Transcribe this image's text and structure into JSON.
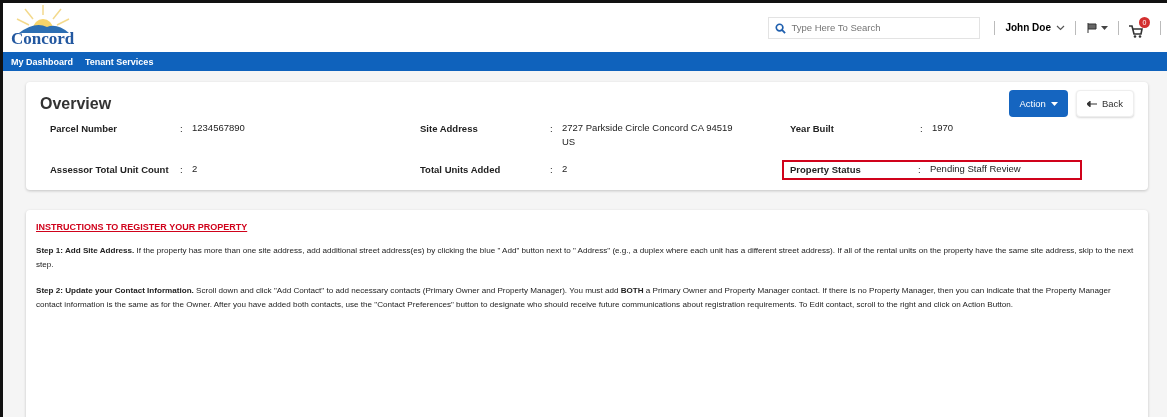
{
  "header": {
    "logo_text": "Concord",
    "search": {
      "placeholder": "Type Here To Search"
    },
    "user": "John Doe",
    "cart_count": "0"
  },
  "nav": [
    {
      "label": "My Dashboard"
    },
    {
      "label": "Tenant Services"
    }
  ],
  "overview": {
    "title": "Overview",
    "buttons": [
      {
        "label": "Action",
        "kind": "primary"
      },
      {
        "label": "Back",
        "kind": "back"
      }
    ],
    "fields": [
      {
        "label": "Parcel Number",
        "separator": ":",
        "value": "1234567890",
        "highlighted": false
      },
      {
        "label": "Site Address",
        "separator": ":",
        "value": "2727 Parkside Circle Concord CA 94519 US",
        "highlighted": false
      },
      {
        "label": "Year Built",
        "separator": ":",
        "value": "1970",
        "highlighted": false
      },
      {
        "label": "Assessor Total Unit Count",
        "separator": ":",
        "value": "2",
        "highlighted": false
      },
      {
        "label": "Total Units Added",
        "separator": ":",
        "value": "2",
        "highlighted": false
      },
      {
        "label": "Property Status",
        "separator": ":",
        "value": "Pending Staff Review",
        "highlighted": true
      }
    ]
  },
  "instructions": {
    "title": "INSTRUCTIONS TO REGISTER YOUR PROPERTY",
    "steps": [
      "**Step 1: Add Site Address.** If the property has more than one site address, add additional street address(es) by clicking the blue \" Add\" button next to \" Address\" (e.g., a duplex where each unit has a different street address). If all of the rental units on the property have the same site address, skip to the next step.",
      "**Step 2: Update your Contact Information.** Scroll down and click \"Add Contact\" to add necessary contacts (Primary Owner and Property Manager). You must add **BOTH** a Primary Owner and Property Manager contact. If there is no Property Manager, then you can indicate that the Property Manager contact information is the same as for the Owner. After you have added both contacts, use the \"Contact Preferences\" button to designate who should receive future communications about registration requirements. To Edit contact, scroll to the right and click on Action Button."
    ]
  }
}
